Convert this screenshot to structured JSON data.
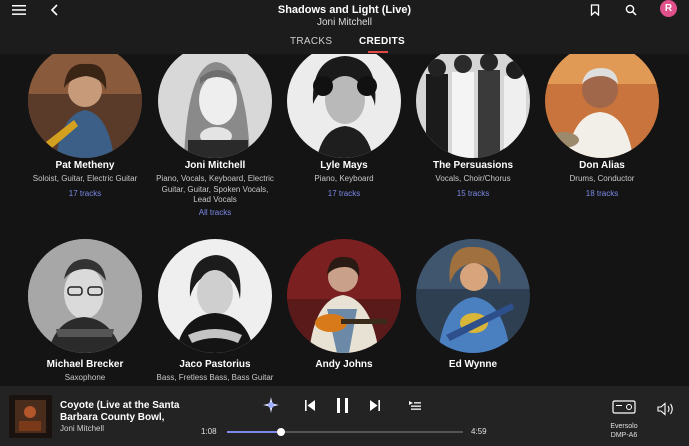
{
  "header": {
    "title": "Shadows and Light (Live)",
    "subtitle": "Joni Mitchell",
    "menu_icon": "hamburger-menu-icon",
    "back_icon": "back-arrow-icon",
    "bookmark_icon": "bookmark-icon",
    "search_icon": "search-icon",
    "avatar_initial": "R",
    "avatar_color": "#e0508a"
  },
  "tabs": [
    {
      "label": "TRACKS",
      "active": false
    },
    {
      "label": "CREDITS",
      "active": true
    }
  ],
  "accent": "#7b89e8",
  "tab_indicator_color": "#e24848",
  "credits": [
    {
      "name": "Pat Metheny",
      "roles": [
        "Soloist, Guitar, Electric Guitar"
      ],
      "link": "17 tracks"
    },
    {
      "name": "Joni Mitchell",
      "roles": [
        "Piano, Vocals, Keyboard, Electric",
        "Guitar, Guitar, Spoken Vocals,",
        "Lead Vocals"
      ],
      "link": "All tracks"
    },
    {
      "name": "Lyle Mays",
      "roles": [
        "Piano, Keyboard"
      ],
      "link": "17 tracks"
    },
    {
      "name": "The Persuasions",
      "roles": [
        "Vocals, Choir/Chorus"
      ],
      "link": "15 tracks"
    },
    {
      "name": "Don Alias",
      "roles": [
        "Drums, Conductor"
      ],
      "link": "18 tracks"
    },
    {
      "name": "Michael Brecker",
      "roles": [
        "Saxophone"
      ],
      "link": ""
    },
    {
      "name": "Jaco Pastorius",
      "roles": [
        "Bass, Fretless Bass, Bass Guitar"
      ],
      "link": ""
    },
    {
      "name": "Andy Johns",
      "roles": [],
      "link": ""
    },
    {
      "name": "Ed Wynne",
      "roles": [],
      "link": ""
    }
  ],
  "player": {
    "track_title_line1": "Coyote (Live at the Santa",
    "track_title_line2": "Barbara County Bowl,",
    "artist": "Joni Mitchell",
    "current_time": "1:08",
    "total_time": "4:59",
    "progress": 0.227,
    "device_name_line1": "Eversolo",
    "device_name_line2": "DMP-A6",
    "icons": [
      "sparkle-icon",
      "skip-previous-icon",
      "pause-icon",
      "skip-next-icon",
      "queue-icon",
      "device-icon",
      "volume-icon"
    ]
  }
}
